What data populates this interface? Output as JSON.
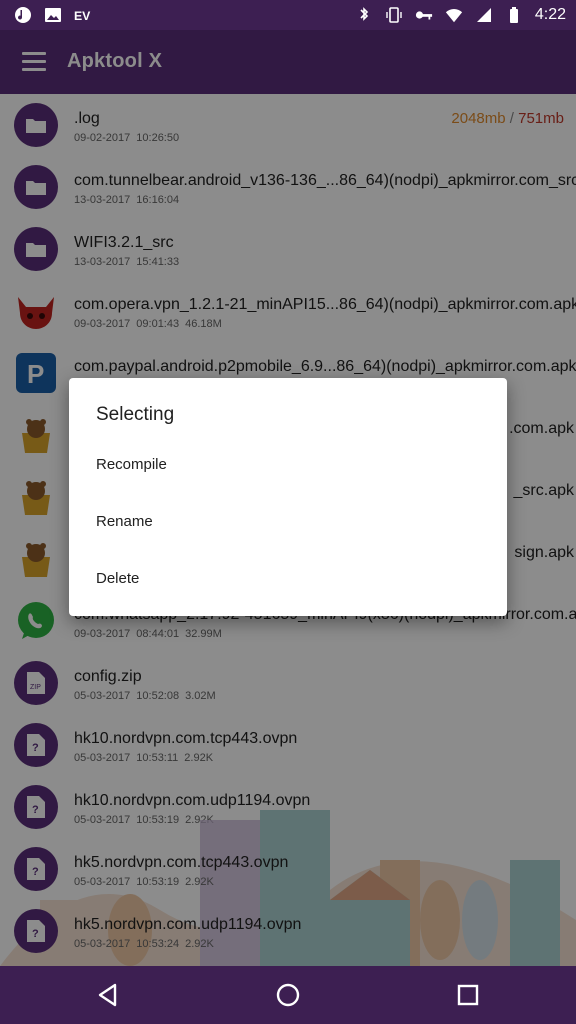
{
  "status": {
    "time": "4:22"
  },
  "app": {
    "title": "Apktool X"
  },
  "storage": {
    "used": "2048mb",
    "separator": "/",
    "free": "751mb"
  },
  "files": [
    {
      "name": ".log",
      "date": "09-02-2017",
      "time": "10:26:50",
      "size": "",
      "icon": "folder-icon"
    },
    {
      "name": "com.tunnelbear.android_v136-136_...86_64)(nodpi)_apkmirror.com_src",
      "date": "13-03-2017",
      "time": "16:16:04",
      "size": "",
      "icon": "folder-icon"
    },
    {
      "name": "WIFI3.2.1_src",
      "date": "13-03-2017",
      "time": "15:41:33",
      "size": "",
      "icon": "folder-icon"
    },
    {
      "name": "com.opera.vpn_1.2.1-21_minAPI15...86_64)(nodpi)_apkmirror.com.apk",
      "date": "09-03-2017",
      "time": "09:01:43",
      "size": "46.18M",
      "icon": "opera-vpn-icon"
    },
    {
      "name": "com.paypal.android.p2pmobile_6.9...86_64)(nodpi)_apkmirror.com.apk",
      "date": "",
      "time": "",
      "size": "",
      "icon": "paypal-icon"
    },
    {
      "name": ".com.apk",
      "date": "",
      "time": "",
      "size": "",
      "icon": "tunnelbear-icon"
    },
    {
      "name": "_src.apk",
      "date": "",
      "time": "",
      "size": "",
      "icon": "tunnelbear-icon"
    },
    {
      "name": "sign.apk",
      "date": "",
      "time": "",
      "size": "",
      "icon": "tunnelbear-icon"
    },
    {
      "name": "com.whatsapp_2.17.92-451659_minAPI9(x86)(nodpi)_apkmirror.com.apk",
      "date": "09-03-2017",
      "time": "08:44:01",
      "size": "32.99M",
      "icon": "whatsapp-icon"
    },
    {
      "name": "config.zip",
      "date": "05-03-2017",
      "time": "10:52:08",
      "size": "3.02M",
      "icon": "zip-file-icon"
    },
    {
      "name": "hk10.nordvpn.com.tcp443.ovpn",
      "date": "05-03-2017",
      "time": "10:53:11",
      "size": "2.92K",
      "icon": "unknown-file-icon"
    },
    {
      "name": "hk10.nordvpn.com.udp1194.ovpn",
      "date": "05-03-2017",
      "time": "10:53:19",
      "size": "2.92K",
      "icon": "unknown-file-icon"
    },
    {
      "name": "hk5.nordvpn.com.tcp443.ovpn",
      "date": "05-03-2017",
      "time": "10:53:19",
      "size": "2.92K",
      "icon": "unknown-file-icon"
    },
    {
      "name": "hk5.nordvpn.com.udp1194.ovpn",
      "date": "05-03-2017",
      "time": "10:53:24",
      "size": "2.92K",
      "icon": "unknown-file-icon"
    }
  ],
  "dialog": {
    "title": "Selecting",
    "options": [
      "Recompile",
      "Rename",
      "Delete"
    ]
  },
  "colors": {
    "primary": "#5a2e7a",
    "statusbar": "#3d1f52",
    "accent": "#e08a2c"
  }
}
